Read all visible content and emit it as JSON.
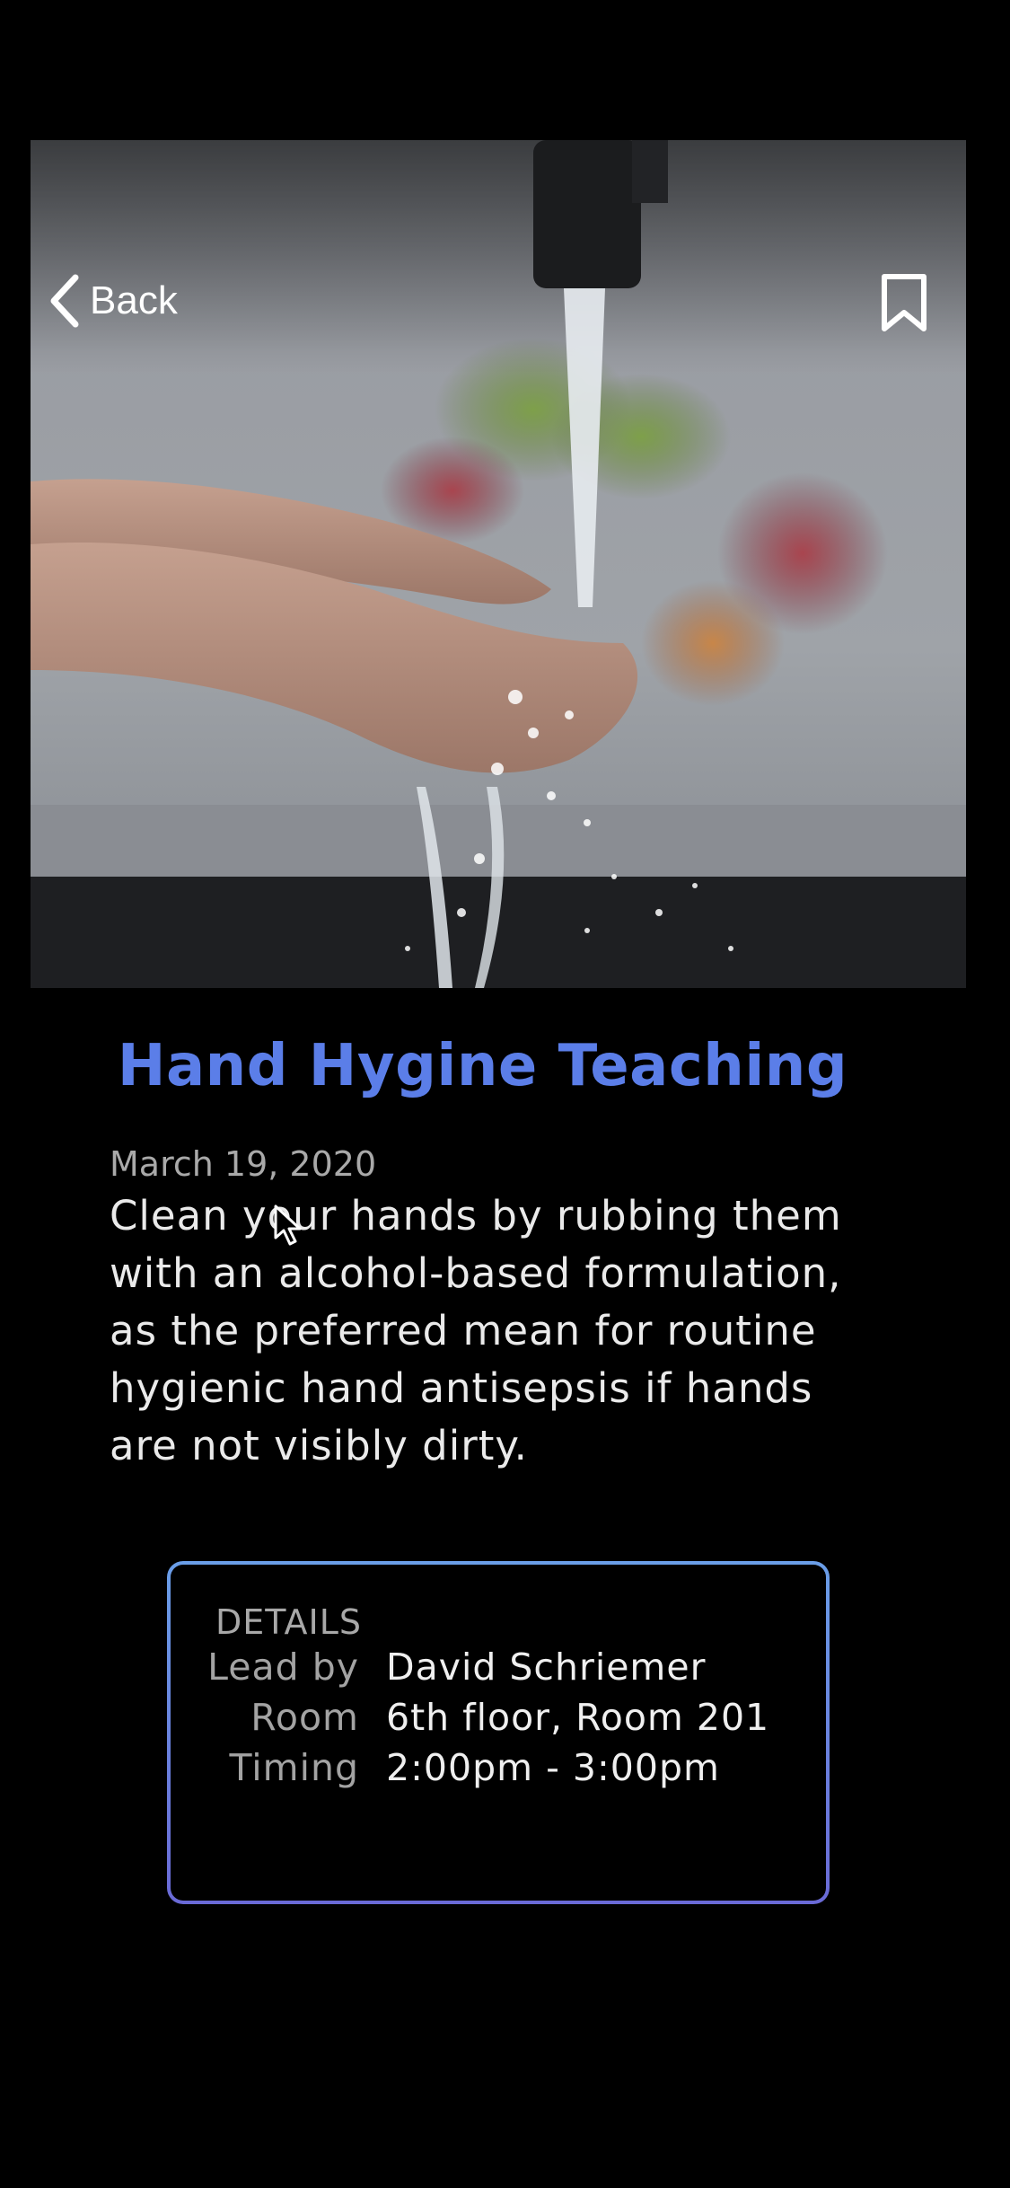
{
  "header": {
    "back_label": "Back",
    "back_icon": "chevron-left-icon",
    "bookmark_icon": "bookmark-icon"
  },
  "hero": {
    "image": "photo of hands being washed under a running kitchen faucet"
  },
  "article": {
    "title": "Hand Hygine Teaching",
    "date": "March 19, 2020",
    "body": "Clean your hands by rubbing them with an alcohol-based formulation, as the preferred mean for routine hygienic hand antisepsis if hands are not visibly dirty."
  },
  "details": {
    "heading": "DETAILS",
    "rows": [
      {
        "label": "Lead by",
        "value": "David Schriemer"
      },
      {
        "label": "Room",
        "value": "6th floor, Room 201"
      },
      {
        "label": "Timing",
        "value": "2:00pm - 3:00pm"
      }
    ]
  },
  "colors": {
    "accent": "#5b7ee8",
    "card_border_top": "#6a9ee8",
    "card_border_bottom": "#6a6ad6",
    "background": "#000000"
  }
}
